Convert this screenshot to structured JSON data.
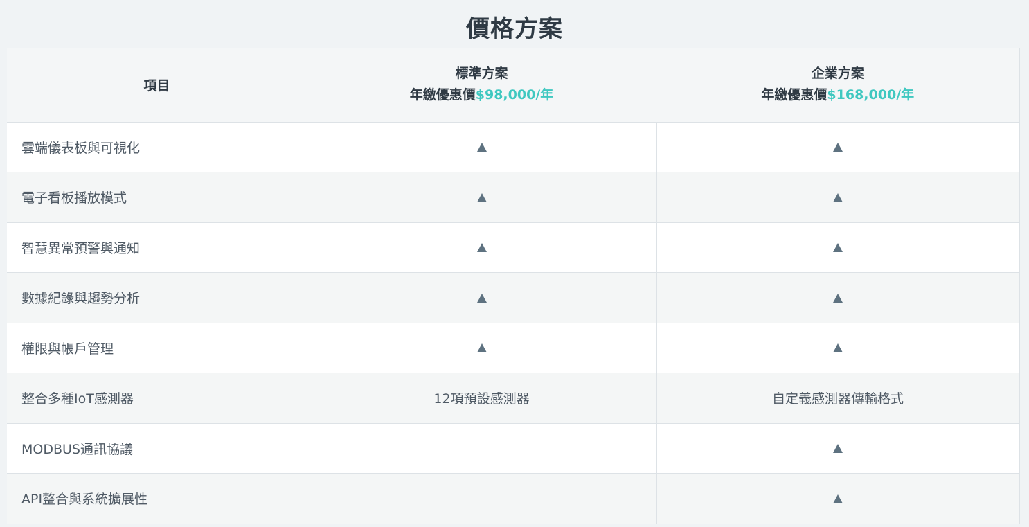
{
  "page": {
    "title": "價格方案"
  },
  "table": {
    "header": {
      "item_label": "項目",
      "plans": [
        {
          "name": "標準方案",
          "price_prefix": "年繳優惠價",
          "price": "$98,000/年"
        },
        {
          "name": "企業方案",
          "price_prefix": "年繳優惠價",
          "price": "$168,000/年"
        }
      ]
    },
    "rows": [
      {
        "feature": "雲端儀表板與可視化",
        "standard": {
          "icon": "triangle-icon"
        },
        "enterprise": {
          "icon": "triangle-icon"
        }
      },
      {
        "feature": "電子看板播放模式",
        "standard": {
          "icon": "triangle-icon"
        },
        "enterprise": {
          "icon": "triangle-icon"
        }
      },
      {
        "feature": "智慧異常預警與通知",
        "standard": {
          "icon": "triangle-icon"
        },
        "enterprise": {
          "icon": "triangle-icon"
        }
      },
      {
        "feature": "數據紀錄與趨勢分析",
        "standard": {
          "icon": "triangle-icon"
        },
        "enterprise": {
          "icon": "triangle-icon"
        }
      },
      {
        "feature": "權限與帳戶管理",
        "standard": {
          "icon": "triangle-icon"
        },
        "enterprise": {
          "icon": "triangle-icon"
        }
      },
      {
        "feature": "整合多種IoT感測器",
        "standard": {
          "text": "12項預設感測器"
        },
        "enterprise": {
          "text": "自定義感測器傳輸格式"
        }
      },
      {
        "feature": "MODBUS通訊協議",
        "standard": {},
        "enterprise": {
          "icon": "triangle-icon"
        }
      },
      {
        "feature": "API整合與系統擴展性",
        "standard": {},
        "enterprise": {
          "icon": "triangle-icon"
        }
      }
    ]
  },
  "colors": {
    "accent": "#3fc8c0",
    "icon": "#5e7280",
    "title": "#2f3a44"
  }
}
